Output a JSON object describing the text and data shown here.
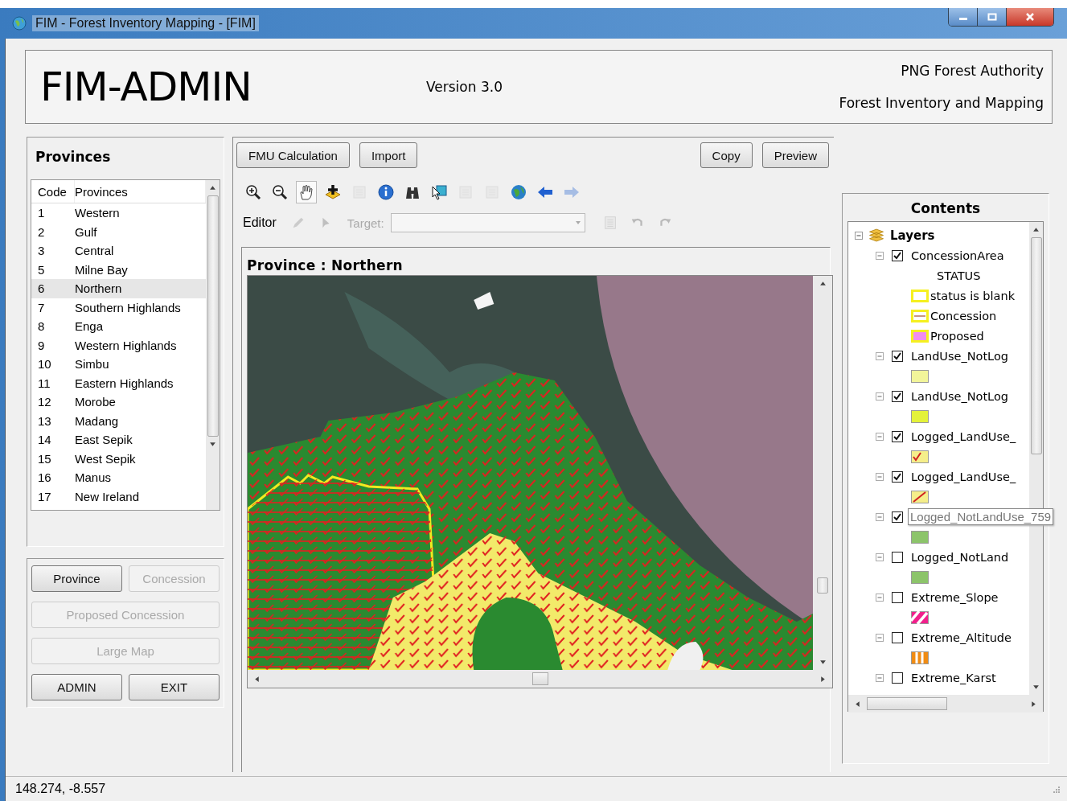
{
  "window": {
    "title": "FIM - Forest Inventory Mapping - [FIM]"
  },
  "header": {
    "app_name": "FIM-ADMIN",
    "version": "Version 3.0",
    "org_lines": [
      "PNG Forest Authority",
      "Forest Inventory and Mapping"
    ]
  },
  "provinces": {
    "title": "Provinces",
    "columns": [
      "Code",
      "Provinces"
    ],
    "rows": [
      {
        "code": "1",
        "name": "Western",
        "selected": false
      },
      {
        "code": "2",
        "name": "Gulf",
        "selected": false
      },
      {
        "code": "3",
        "name": "Central",
        "selected": false
      },
      {
        "code": "5",
        "name": "Milne Bay",
        "selected": false
      },
      {
        "code": "6",
        "name": "Northern",
        "selected": true
      },
      {
        "code": "7",
        "name": "Southern Highlands",
        "selected": false
      },
      {
        "code": "8",
        "name": "Enga",
        "selected": false
      },
      {
        "code": "9",
        "name": "Western Highlands",
        "selected": false
      },
      {
        "code": "10",
        "name": "Simbu",
        "selected": false
      },
      {
        "code": "11",
        "name": "Eastern Highlands",
        "selected": false
      },
      {
        "code": "12",
        "name": "Morobe",
        "selected": false
      },
      {
        "code": "13",
        "name": "Madang",
        "selected": false
      },
      {
        "code": "14",
        "name": "East Sepik",
        "selected": false
      },
      {
        "code": "15",
        "name": "West Sepik",
        "selected": false
      },
      {
        "code": "16",
        "name": "Manus",
        "selected": false
      },
      {
        "code": "17",
        "name": "New Ireland",
        "selected": false
      }
    ]
  },
  "side_buttons": [
    [
      {
        "label": "Province",
        "disabled": false
      },
      {
        "label": "Concession",
        "disabled": true
      }
    ],
    [
      {
        "label": "Proposed Concession",
        "disabled": true
      }
    ],
    [
      {
        "label": "Large Map",
        "disabled": true
      }
    ],
    [
      {
        "label": "ADMIN",
        "disabled": false
      },
      {
        "label": "EXIT",
        "disabled": false
      }
    ]
  ],
  "top_buttons_left": [
    "FMU Calculation",
    "Import"
  ],
  "top_buttons_right": [
    "Copy",
    "Preview"
  ],
  "toolbar": {
    "tools": [
      {
        "kind": "zoom-in",
        "selected": false,
        "disabled": false
      },
      {
        "kind": "zoom-out",
        "selected": false,
        "disabled": false
      },
      {
        "kind": "pan",
        "selected": true,
        "disabled": false
      },
      {
        "kind": "add-data",
        "selected": false,
        "disabled": false
      },
      {
        "kind": "square",
        "selected": false,
        "disabled": true
      },
      {
        "kind": "info",
        "selected": false,
        "disabled": false
      },
      {
        "kind": "binoculars",
        "selected": false,
        "disabled": false
      },
      {
        "kind": "select",
        "selected": false,
        "disabled": false
      },
      {
        "kind": "stack",
        "selected": false,
        "disabled": true
      },
      {
        "kind": "square",
        "selected": false,
        "disabled": true
      },
      {
        "kind": "globe",
        "selected": false,
        "disabled": false
      },
      {
        "kind": "back",
        "selected": false,
        "disabled": false
      },
      {
        "kind": "forward",
        "selected": false,
        "disabled": true
      }
    ]
  },
  "editor": {
    "label": "Editor",
    "target_label": "Target:",
    "tools_before": [
      {
        "kind": "pencil",
        "disabled": true
      },
      {
        "kind": "pointer",
        "disabled": true
      }
    ],
    "tools_after": [
      {
        "kind": "sheet",
        "disabled": true
      },
      {
        "kind": "undo",
        "disabled": true
      },
      {
        "kind": "redo",
        "disabled": true
      }
    ]
  },
  "map": {
    "title": "Province :  Northern"
  },
  "contents": {
    "title": "Contents",
    "root": {
      "label": "Layers",
      "expanded": true,
      "children": [
        {
          "label": "ConcessionArea",
          "checked": true,
          "expanded": true,
          "hovered": false,
          "legend_heading": "STATUS",
          "legend": [
            {
              "label": "status is blank",
              "color": "#ffffff",
              "kind": "outlined"
            },
            {
              "label": "Concession",
              "color": "#ffffff",
              "kind": "outlined-line"
            },
            {
              "label": "Proposed",
              "color": "#f08cf0",
              "kind": "outlined"
            }
          ]
        },
        {
          "label": "LandUse_NotLog",
          "checked": true,
          "expanded": true,
          "hovered": false,
          "legend": [
            {
              "color": "#f2f59a",
              "kind": "solid"
            }
          ]
        },
        {
          "label": "LandUse_NotLog",
          "checked": true,
          "expanded": true,
          "hovered": false,
          "legend": [
            {
              "color": "#e4f23a",
              "kind": "solid"
            }
          ]
        },
        {
          "label": "Logged_LandUse_",
          "checked": true,
          "expanded": true,
          "hovered": false,
          "legend": [
            {
              "color": "#f5ee8a",
              "kind": "check"
            }
          ]
        },
        {
          "label": "Logged_LandUse_",
          "checked": true,
          "expanded": true,
          "hovered": false,
          "legend": [
            {
              "color": "#f5ee8a",
              "kind": "diagonal-line"
            }
          ]
        },
        {
          "label": "Logged_NotLandUse_759",
          "checked": true,
          "expanded": true,
          "hovered": true,
          "legend": [
            {
              "color": "#8cc46a",
              "kind": "solid"
            }
          ]
        },
        {
          "label": "Logged_NotLand",
          "checked": false,
          "expanded": true,
          "hovered": false,
          "legend": [
            {
              "color": "#8cc46a",
              "kind": "solid"
            }
          ]
        },
        {
          "label": "Extreme_Slope",
          "checked": false,
          "expanded": true,
          "hovered": false,
          "legend": [
            {
              "color": "#f0208c",
              "kind": "diagonal-stripes"
            }
          ]
        },
        {
          "label": "Extreme_Altitude",
          "checked": false,
          "expanded": true,
          "hovered": false,
          "legend": [
            {
              "color": "#f08c14",
              "kind": "vertical-stripes"
            }
          ]
        },
        {
          "label": "Extreme_Karst",
          "checked": false,
          "expanded": true,
          "hovered": false
        }
      ]
    }
  },
  "status_bar": {
    "coordinates": "148.274, -8.557"
  }
}
